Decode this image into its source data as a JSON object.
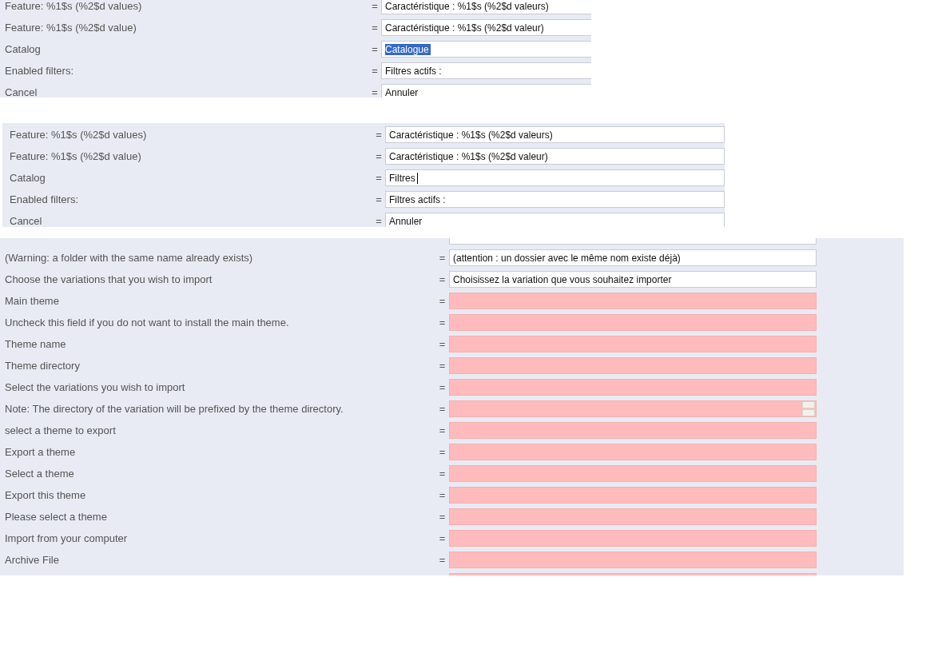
{
  "panels": [
    {
      "rows": [
        {
          "kind": "text",
          "source": "Feature: %1$s (%2$d values)",
          "separator": "=",
          "translation": "Caractéristique : %1$s (%2$d valeurs)",
          "filled": true,
          "highlighted": false
        },
        {
          "kind": "text",
          "source": "Feature: %1$s (%2$d value)",
          "separator": "=",
          "translation": "Caractéristique : %1$s (%2$d valeur)",
          "filled": true,
          "highlighted": false
        },
        {
          "kind": "text",
          "source": "Catalog",
          "separator": "=",
          "translation": "Catalogue",
          "filled": true,
          "highlighted": true
        },
        {
          "kind": "text",
          "source": "Enabled filters:",
          "separator": "=",
          "translation": "Filtres actifs :",
          "filled": true,
          "highlighted": false
        },
        {
          "kind": "text",
          "source": "Cancel",
          "separator": "=",
          "translation": "Annuler",
          "filled": true,
          "highlighted": false
        }
      ]
    },
    {
      "rows": [
        {
          "kind": "text",
          "source": "Feature: %1$s (%2$d values)",
          "separator": "=",
          "translation": "Caractéristique : %1$s (%2$d valeurs)",
          "filled": true,
          "caret": false
        },
        {
          "kind": "text",
          "source": "Feature: %1$s (%2$d value)",
          "separator": "=",
          "translation": "Caractéristique : %1$s (%2$d valeur)",
          "filled": true,
          "caret": false
        },
        {
          "kind": "text",
          "source": "Catalog",
          "separator": "=",
          "translation": "Filtres",
          "filled": true,
          "caret": true
        },
        {
          "kind": "text",
          "source": "Enabled filters:",
          "separator": "=",
          "translation": "Filtres actifs :",
          "filled": true,
          "caret": false
        },
        {
          "kind": "text",
          "source": "Cancel",
          "separator": "=",
          "translation": "Annuler",
          "filled": true,
          "caret": false
        }
      ]
    },
    {
      "rows": [
        {
          "kind": "cut",
          "filled": true
        },
        {
          "kind": "text",
          "source": "(Warning: a folder with the same name already exists)",
          "separator": "=",
          "translation": "(attention : un dossier avec le même nom existe déjà)",
          "filled": true
        },
        {
          "kind": "text",
          "source": "Choose the variations that you wish to import",
          "separator": "=",
          "translation": "Choisissez la variation que vous souhaitez importer",
          "filled": true
        },
        {
          "kind": "text",
          "source": "Main theme",
          "separator": "=",
          "filled": false
        },
        {
          "kind": "text",
          "source": "Uncheck this field if you do not want to install the main theme.",
          "separator": "=",
          "filled": false
        },
        {
          "kind": "text",
          "source": "Theme name",
          "separator": "=",
          "filled": false
        },
        {
          "kind": "text",
          "source": "Theme directory",
          "separator": "=",
          "filled": false
        },
        {
          "kind": "text",
          "source": "Select the variations you wish to import",
          "separator": "=",
          "filled": false
        },
        {
          "kind": "textarea",
          "source": "Note: The directory of the variation will be prefixed by the theme directory.",
          "separator": "=",
          "filled": false
        },
        {
          "kind": "text",
          "source": "select a theme to export",
          "separator": "=",
          "filled": false
        },
        {
          "kind": "text",
          "source": "Export a theme",
          "separator": "=",
          "filled": false
        },
        {
          "kind": "text",
          "source": "Select a theme",
          "separator": "=",
          "filled": false
        },
        {
          "kind": "text",
          "source": "Export this theme",
          "separator": "=",
          "filled": false
        },
        {
          "kind": "text",
          "source": "Please select a theme",
          "separator": "=",
          "filled": false
        },
        {
          "kind": "text",
          "source": "Import from your computer",
          "separator": "=",
          "filled": false
        },
        {
          "kind": "text",
          "source": "Archive File",
          "separator": "=",
          "filled": false
        },
        {
          "kind": "cut",
          "filled": false
        }
      ]
    }
  ]
}
